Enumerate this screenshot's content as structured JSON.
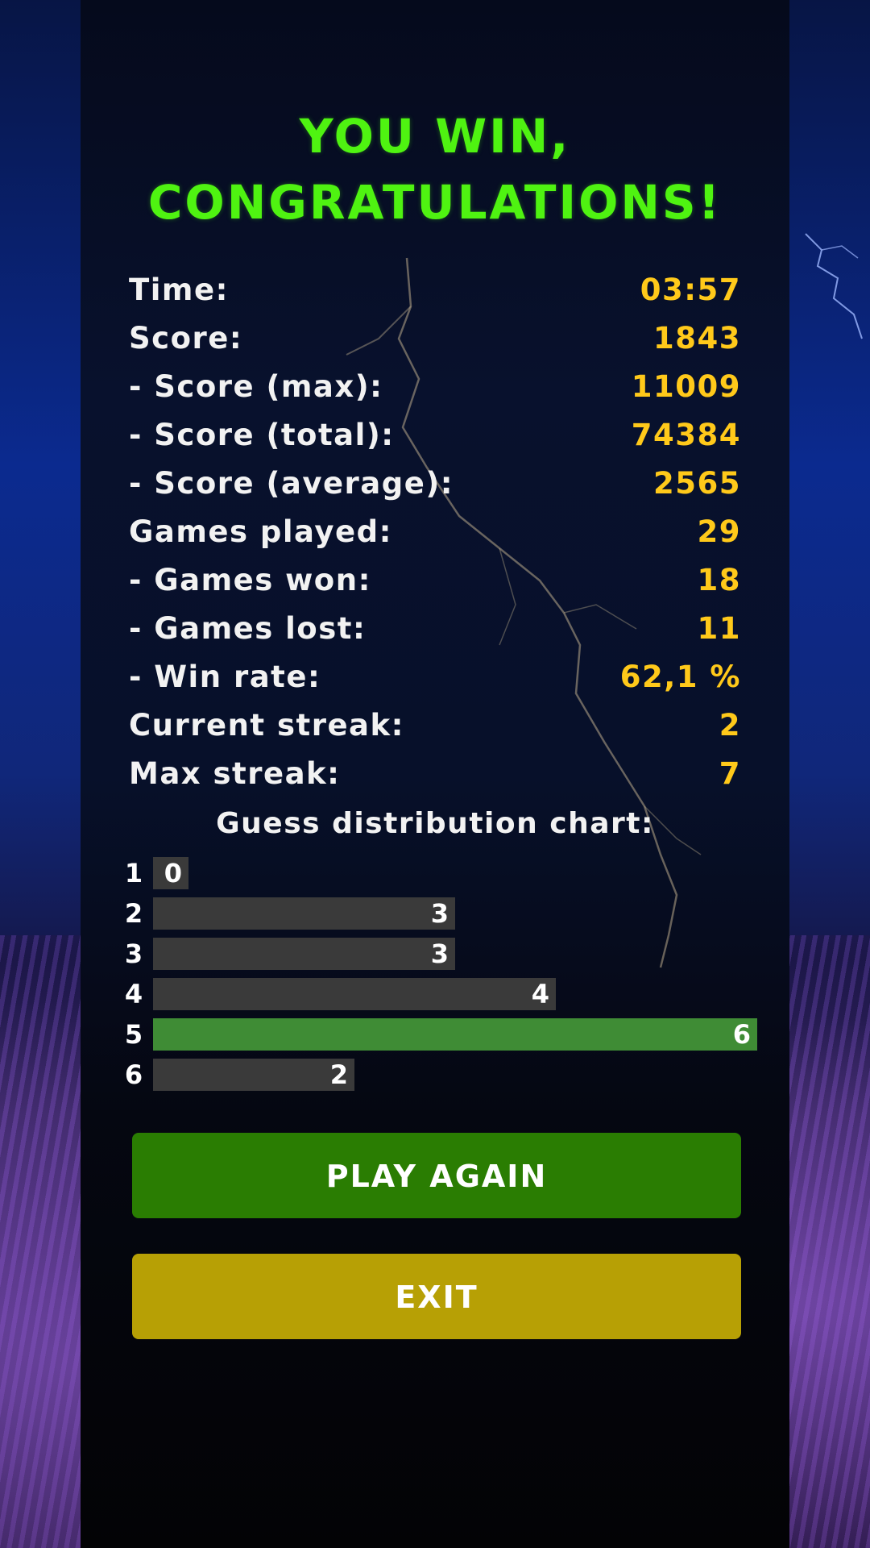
{
  "title": {
    "line1": "YOU WIN,",
    "line2": "CONGRATULATIONS!"
  },
  "stats": [
    {
      "label": "Time:",
      "value": "03:57"
    },
    {
      "label": "Score:",
      "value": "1843"
    },
    {
      "label": "- Score (max):",
      "value": "11009"
    },
    {
      "label": "- Score (total):",
      "value": "74384"
    },
    {
      "label": "- Score (average):",
      "value": "2565"
    },
    {
      "label": "Games played:",
      "value": "29"
    },
    {
      "label": "- Games won:",
      "value": "18"
    },
    {
      "label": "- Games lost:",
      "value": "11"
    },
    {
      "label": "- Win rate:",
      "value": "62,1 %"
    },
    {
      "label": "Current streak:",
      "value": "2"
    },
    {
      "label": "Max streak:",
      "value": "7"
    }
  ],
  "chart_title": "Guess distribution chart:",
  "chart_data": {
    "type": "bar",
    "orientation": "horizontal",
    "categories": [
      "1",
      "2",
      "3",
      "4",
      "5",
      "6"
    ],
    "values": [
      0,
      3,
      3,
      4,
      6,
      2
    ],
    "highlight_index": 4,
    "title": "Guess distribution chart:",
    "xlim": [
      0,
      6
    ]
  },
  "buttons": {
    "play_again": "PLAY AGAIN",
    "exit": "EXIT"
  },
  "colors": {
    "title": "#4ff311",
    "stat_value": "#ffc91a",
    "bar": "#3a3a3a",
    "bar_highlight": "#3f8c35",
    "play_button": "#2a7d02",
    "exit_button": "#b7a005"
  }
}
